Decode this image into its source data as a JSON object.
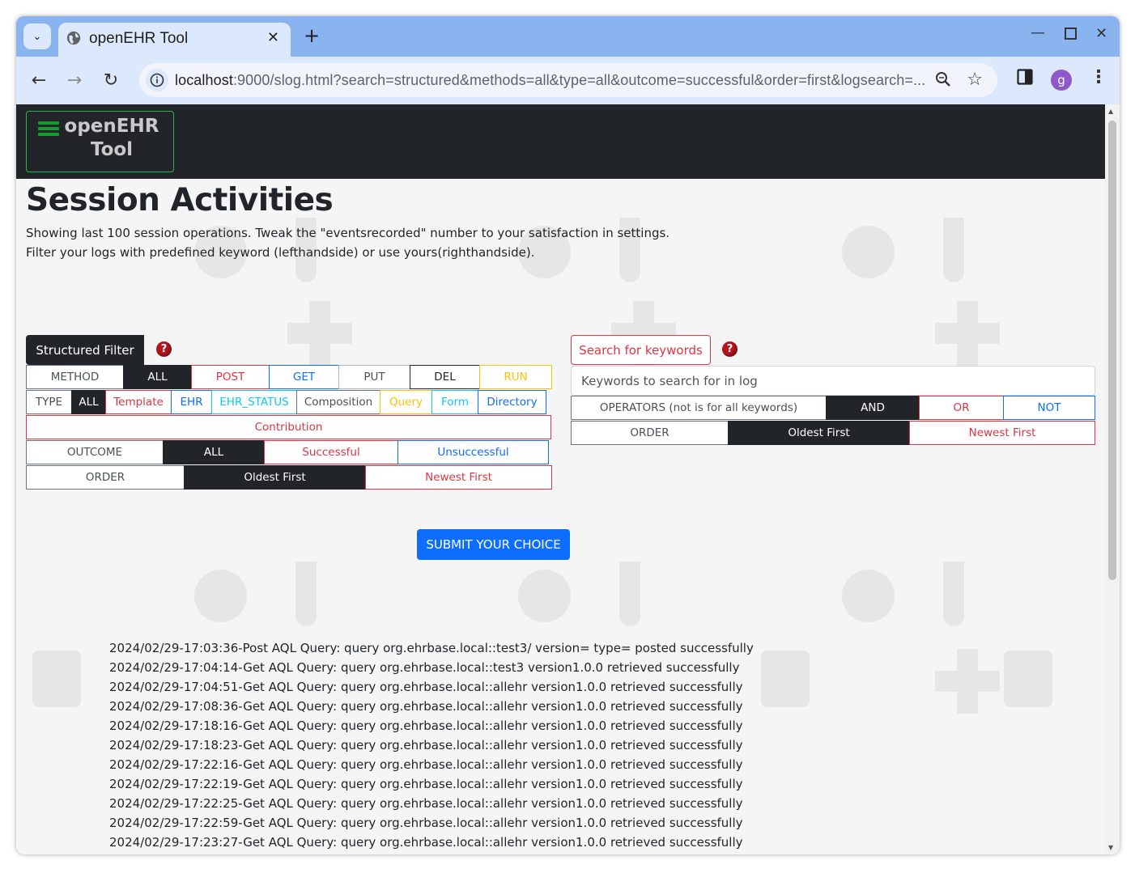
{
  "browser": {
    "tab_title": "openEHR Tool",
    "url_host": "localhost",
    "url_rest": ":9000/slog.html?search=structured&methods=all&type=all&outcome=successful&order=first&logsearch=...",
    "avatar_letter": "g"
  },
  "navbar": {
    "brand_line1": "openEHR",
    "brand_line2": "Tool"
  },
  "page": {
    "title": "Session Activities",
    "desc1": "Showing last 100 session operations. Tweak the \"eventsrecorded\" number to your satisfaction in settings.",
    "desc2": "Filter your logs with predefined keyword (lefthandside) or use yours(righthandside)."
  },
  "structured": {
    "button": "Structured Filter",
    "help": "?",
    "method": [
      "METHOD",
      "ALL",
      "POST",
      "GET",
      "PUT",
      "DEL",
      "RUN"
    ],
    "type": [
      "TYPE",
      "ALL",
      "Template",
      "EHR",
      "EHR_STATUS",
      "Composition",
      "Query",
      "Form",
      "Directory"
    ],
    "type_extra": "Contribution",
    "outcome": [
      "OUTCOME",
      "ALL",
      "Successful",
      "Unsuccessful"
    ],
    "order": [
      "ORDER",
      "Oldest First",
      "Newest First"
    ]
  },
  "keywords": {
    "button": "Search for keywords",
    "help": "?",
    "placeholder": "Keywords to search for in log",
    "operators": [
      "OPERATORS (not is for all keywords)",
      "AND",
      "OR",
      "NOT"
    ],
    "order": [
      "ORDER",
      "Oldest First",
      "Newest First"
    ]
  },
  "submit_label": "SUBMIT YOUR CHOICE",
  "log_lines": [
    "2024/02/29-17:03:36-Post AQL Query: query org.ehrbase.local::test3/ version= type= posted successfully",
    "2024/02/29-17:04:14-Get AQL Query: query org.ehrbase.local::test3 version1.0.0 retrieved successfully",
    "2024/02/29-17:04:51-Get AQL Query: query org.ehrbase.local::allehr version1.0.0 retrieved successfully",
    "2024/02/29-17:08:36-Get AQL Query: query org.ehrbase.local::allehr version1.0.0 retrieved successfully",
    "2024/02/29-17:18:16-Get AQL Query: query org.ehrbase.local::allehr version1.0.0 retrieved successfully",
    "2024/02/29-17:18:23-Get AQL Query: query org.ehrbase.local::allehr version1.0.0 retrieved successfully",
    "2024/02/29-17:22:16-Get AQL Query: query org.ehrbase.local::allehr version1.0.0 retrieved successfully",
    "2024/02/29-17:22:19-Get AQL Query: query org.ehrbase.local::allehr version1.0.0 retrieved successfully",
    "2024/02/29-17:22:25-Get AQL Query: query org.ehrbase.local::allehr version1.0.0 retrieved successfully",
    "2024/02/29-17:22:59-Get AQL Query: query org.ehrbase.local::allehr version1.0.0 retrieved successfully",
    "2024/02/29-17:23:27-Get AQL Query: query org.ehrbase.local::allehr version1.0.0 retrieved successfully"
  ]
}
